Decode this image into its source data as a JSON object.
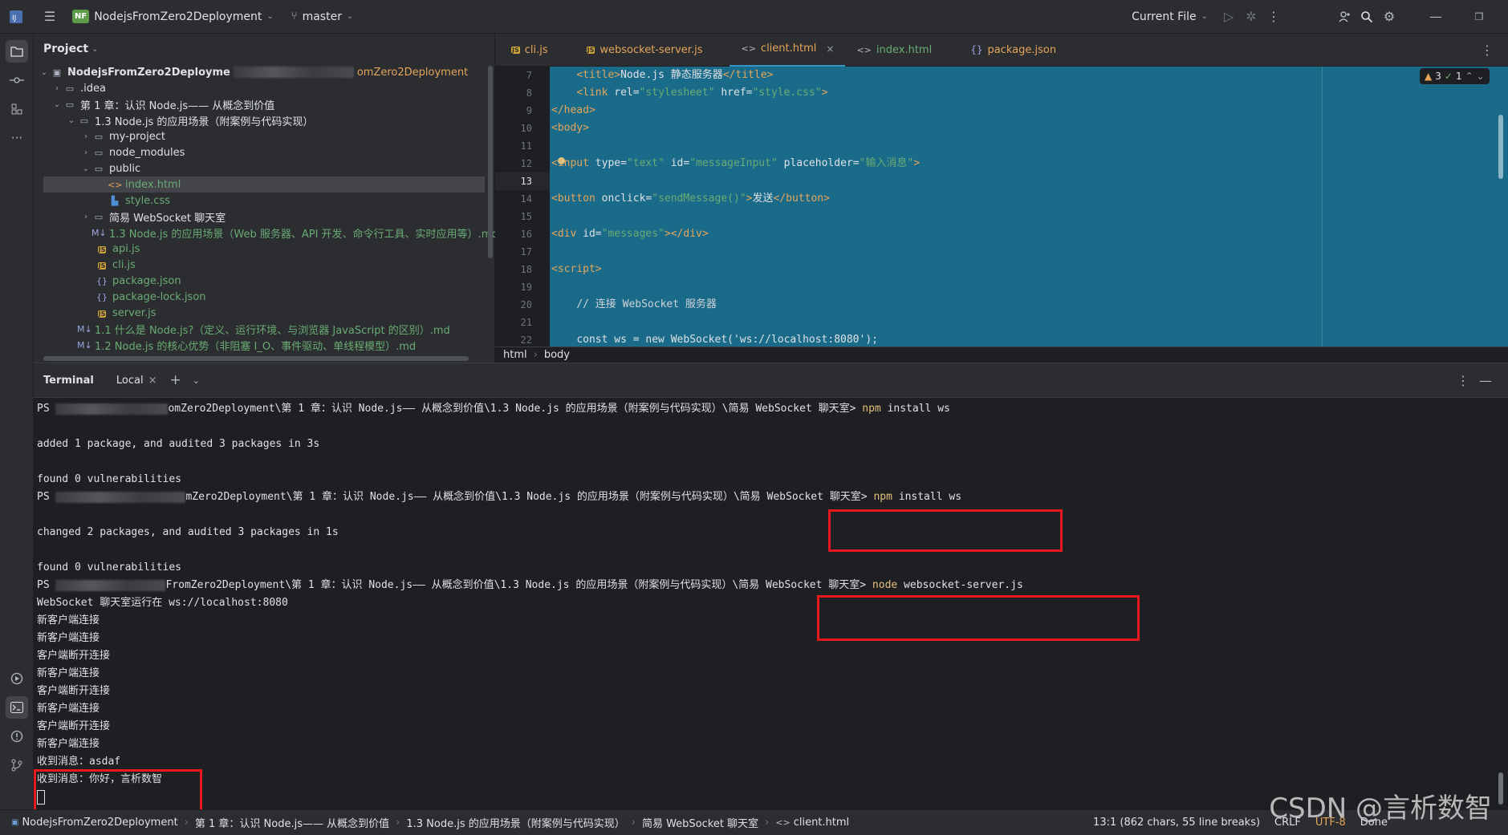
{
  "titlebar": {
    "project_badge": "NF",
    "project_name": "NodejsFromZero2Deployment",
    "branch": "master",
    "run_config": "Current File"
  },
  "project_panel": {
    "title": "Project",
    "items": [
      {
        "label": "NodejsFromZero2Deployme",
        "suffix": "omZero2Deployment",
        "type": "root"
      },
      {
        "label": ".idea",
        "type": "folder"
      },
      {
        "label": "第 1 章：认识 Node.js—— 从概念到价值",
        "type": "folder"
      },
      {
        "label": "1.3 Node.js 的应用场景（附案例与代码实现）",
        "type": "folder"
      },
      {
        "label": "my-project",
        "type": "folder"
      },
      {
        "label": "node_modules",
        "type": "folder"
      },
      {
        "label": "public",
        "type": "folder"
      },
      {
        "label": "index.html",
        "type": "html"
      },
      {
        "label": "style.css",
        "type": "css"
      },
      {
        "label": "简易 WebSocket 聊天室",
        "type": "folder"
      },
      {
        "label": "1.3 Node.js 的应用场景（Web 服务器、API 开发、命令行工具、实时应用等）.md",
        "type": "md"
      },
      {
        "label": "api.js",
        "type": "js"
      },
      {
        "label": "cli.js",
        "type": "js"
      },
      {
        "label": "package.json",
        "type": "json"
      },
      {
        "label": "package-lock.json",
        "type": "json"
      },
      {
        "label": "server.js",
        "type": "js"
      },
      {
        "label": "1.1 什么是 Node.js?（定义、运行环境、与浏览器 JavaScript 的区别）.md",
        "type": "md"
      },
      {
        "label": "1.2 Node.js 的核心优势（非阻塞 I_O、事件驱动、单线程模型）.md",
        "type": "md"
      }
    ]
  },
  "editor": {
    "tabs": [
      {
        "label": "cli.js",
        "icon": "js"
      },
      {
        "label": "websocket-server.js",
        "icon": "js"
      },
      {
        "label": "client.html",
        "icon": "html"
      },
      {
        "label": "index.html",
        "icon": "html"
      },
      {
        "label": "package.json",
        "icon": "json"
      }
    ],
    "inspection": {
      "warnings": "3",
      "ok": "1"
    },
    "line_numbers": [
      "7",
      "8",
      "9",
      "10",
      "11",
      "12",
      "13",
      "14",
      "15",
      "16",
      "17",
      "18",
      "19",
      "20",
      "21",
      "22"
    ],
    "lines": {
      "l7_open": "<title>",
      "l7_text": "Node.js 静态服务器",
      "l7_close": "</title>",
      "l8_tag": "<link",
      "l8_a1": "rel",
      "l8_v1": "\"stylesheet\"",
      "l8_a2": "href",
      "l8_v2": "\"style.css\"",
      "l8_end": ">",
      "l9": "</head>",
      "l10": "<body>",
      "l12_tag": "<input",
      "l12_a1": "type",
      "l12_v1": "\"text\"",
      "l12_a2": "id",
      "l12_v2": "\"messageInput\"",
      "l12_a3": "placeholder",
      "l12_v3": "\"输入消息\"",
      "l12_end": ">",
      "l14_tag": "<button",
      "l14_a1": "onclick",
      "l14_v1": "\"sendMessage()\"",
      "l14_gt": ">",
      "l14_text": "发送",
      "l14_close": "</button>",
      "l16_tag": "<div",
      "l16_a1": "id",
      "l16_v1": "\"messages\"",
      "l16_close": "></div>",
      "l18": "<script>",
      "l20": "// 连接 WebSocket 服务器",
      "l22": "const ws = new WebSocket('ws://localhost:8080');"
    },
    "breadcrumb": [
      "html",
      "body"
    ]
  },
  "terminal": {
    "title": "Terminal",
    "tab": "Local",
    "lines": [
      {
        "prefix": "PS",
        "path": "omZero2Deployment\\第 1 章：认识 Node.js—— 从概念到价值\\1.3 Node.js 的应用场景（附案例与代码实现）\\简易 WebSocket 聊天室> ",
        "cmd": "npm",
        "args": " install ws"
      },
      {
        "text": ""
      },
      {
        "text": "added 1 package, and audited 3 packages in 3s"
      },
      {
        "text": ""
      },
      {
        "text": "found 0 vulnerabilities"
      },
      {
        "prefix": "PS",
        "path": "mZero2Deployment\\第 1 章：认识 Node.js—— 从概念到价值\\1.3 Node.js 的应用场景（附案例与代码实现）\\简易 WebSocket 聊天室> ",
        "cmd": "npm",
        "args": " install ws"
      },
      {
        "text": ""
      },
      {
        "text": "changed 2 packages, and audited 3 packages in 1s"
      },
      {
        "text": ""
      },
      {
        "text": "found 0 vulnerabilities"
      },
      {
        "prefix": "PS",
        "path": "FromZero2Deployment\\第 1 章：认识 Node.js—— 从概念到价值\\1.3 Node.js 的应用场景（附案例与代码实现）\\简易 WebSocket 聊天室> ",
        "cmd": "node",
        "args": " websocket-server.js"
      },
      {
        "text": "WebSocket 聊天室运行在 ws://localhost:8080"
      },
      {
        "text": "新客户端连接"
      },
      {
        "text": "新客户端连接"
      },
      {
        "text": "客户端断开连接"
      },
      {
        "text": "新客户端连接"
      },
      {
        "text": "客户端断开连接"
      },
      {
        "text": "新客户端连接"
      },
      {
        "text": "客户端断开连接"
      },
      {
        "text": "新客户端连接"
      },
      {
        "text": "收到消息：asdaf"
      },
      {
        "text": "收到消息：你好，言析数智"
      }
    ]
  },
  "statusbar": {
    "crumbs": [
      "NodejsFromZero2Deployment",
      "第 1 章：认识 Node.js—— 从概念到价值",
      "1.3 Node.js 的应用场景（附案例与代码实现）",
      "简易 WebSocket 聊天室",
      "client.html"
    ],
    "position": "13:1 (862 chars, 55 line breaks)",
    "line_ending": "CRLF",
    "encoding": "UTF-8",
    "status": "Done"
  },
  "watermark": "CSDN @言析数智",
  "colors": {
    "accent": "#3592c4",
    "highlight": "#e8191e",
    "editor_bg": "#1a6a8a"
  }
}
